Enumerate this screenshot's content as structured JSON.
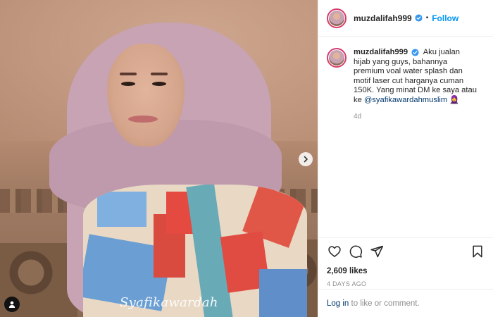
{
  "post": {
    "username": "muzdalifah999",
    "verified": true,
    "follow_label": "Follow",
    "separator": "•",
    "caption_text": "Aku jualan hijab yang guys, bahannya premium voal water splash dan motif laser cut harganya cuman 150K. Yang minat DM ke saya atau ke",
    "caption_mention": "@syafikawardahmuslim",
    "caption_trailing": "🧕",
    "time_short": "4d",
    "likes": "2,609 likes",
    "time_long": "4 DAYS AGO"
  },
  "image": {
    "watermark": "Syafikawardah"
  },
  "footer": {
    "login_link": "Log in",
    "login_suffix": " to like or comment."
  },
  "icons": {
    "next": "chevron-right-icon",
    "user_tag": "user-tag-icon",
    "like": "heart-icon",
    "comment": "comment-icon",
    "share": "paper-plane-icon",
    "save": "bookmark-icon",
    "verified": "verified-badge-icon"
  },
  "colors": {
    "accent": "#0095f6",
    "mention": "#00376b",
    "muted": "#8e8e8e",
    "verified": "#3897f0"
  }
}
